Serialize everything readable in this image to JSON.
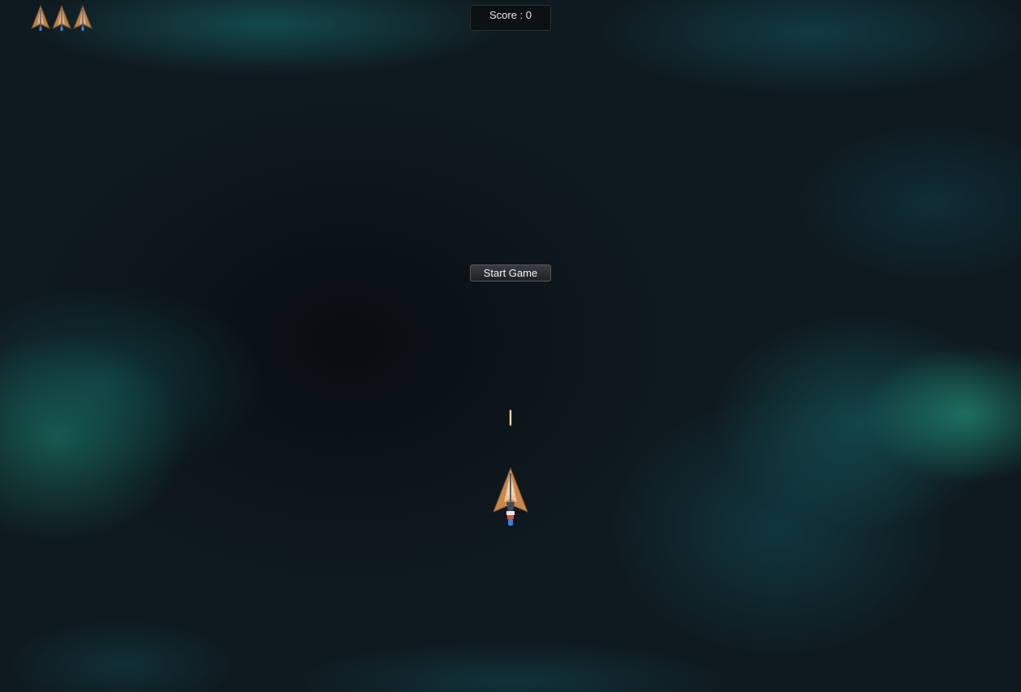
{
  "hud": {
    "score_text": "Score : 0",
    "lives": 3,
    "life_icon": "ship-icon"
  },
  "menu": {
    "start_label": "Start Game"
  },
  "colors": {
    "nebula": "#1a8a7e",
    "space": "#0c1116",
    "ship_hull": "#c9874e",
    "bullet": "#f4b070"
  }
}
